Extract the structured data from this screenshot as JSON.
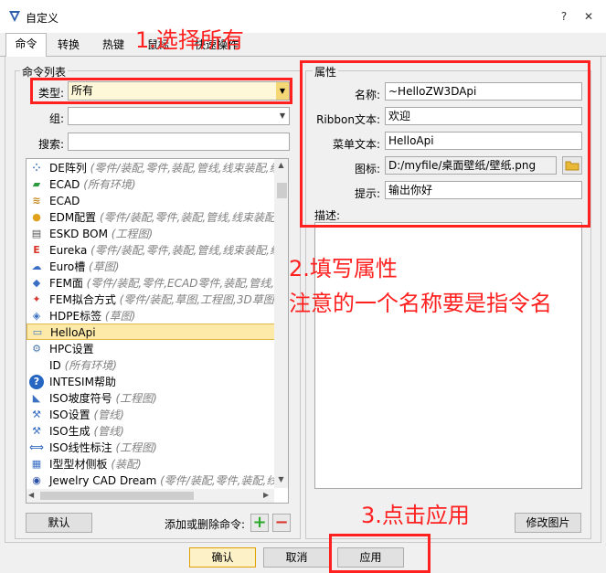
{
  "window": {
    "title": "自定义",
    "help_glyph": "?",
    "close_glyph": "✕"
  },
  "tabs": [
    {
      "label": "命令"
    },
    {
      "label": "转换"
    },
    {
      "label": "热键"
    },
    {
      "label": "鼠标"
    },
    {
      "label": "快速操作"
    }
  ],
  "command_list": {
    "group_title": "命令列表",
    "type_label": "类型:",
    "type_value": "所有",
    "group_label": "组:",
    "group_value": "",
    "search_label": "搜索:",
    "search_value": "",
    "items": [
      {
        "name": "DE阵列",
        "sub": "(零件/装配,零件,装配,管线,线束装配,线",
        "icon": "grid-icon",
        "glyph": "⁘",
        "color": "#3a6fc4"
      },
      {
        "name": "ECAD",
        "sub": "(所有环境)",
        "icon": "ecad-board-icon",
        "glyph": "▰",
        "color": "#2e9a40"
      },
      {
        "name": "ECAD",
        "sub": "",
        "icon": "ecad-chip-icon",
        "glyph": "≋",
        "color": "#c78a1d"
      },
      {
        "name": "EDM配置",
        "sub": "(零件/装配,零件,装配,管线,线束装配,",
        "icon": "edm-icon",
        "glyph": "●",
        "color": "#e0a21a"
      },
      {
        "name": "ESKD BOM",
        "sub": "(工程图)",
        "icon": "bom-icon",
        "glyph": "▤",
        "color": "#555555"
      },
      {
        "name": "Eureka",
        "sub": "(零件/装配,零件,装配,管线,线束装配,线束",
        "icon": "eureka-icon",
        "glyph": "E",
        "color": "#d9352b"
      },
      {
        "name": "Euro槽",
        "sub": "(草图)",
        "icon": "euro-slot-icon",
        "glyph": "☁",
        "color": "#3a6fc4"
      },
      {
        "name": "FEM面",
        "sub": "(零件/装配,零件,ECAD零件,装配,管线,线",
        "icon": "fem-face-icon",
        "glyph": "◆",
        "color": "#3a6fc4"
      },
      {
        "name": "FEM拟合方式",
        "sub": "(零件/装配,草图,工程图,3D草图,",
        "icon": "fem-fit-icon",
        "glyph": "✦",
        "color": "#d9352b"
      },
      {
        "name": "HDPE标签",
        "sub": "(草图)",
        "icon": "hdpe-tag-icon",
        "glyph": "◈",
        "color": "#3a6fc4"
      },
      {
        "name": "HelloApi",
        "sub": "",
        "icon": "helloapi-icon",
        "glyph": "▭",
        "color": "#3a78c8"
      },
      {
        "name": "HPC设置",
        "sub": "",
        "icon": "hpc-icon",
        "glyph": "⚙",
        "color": "#4c78b0"
      },
      {
        "name": "ID",
        "sub": "(所有环境)",
        "icon": "blank-icon",
        "glyph": "",
        "color": "#000000"
      },
      {
        "name": "INTESIM帮助",
        "sub": "",
        "icon": "help-icon",
        "glyph": "?",
        "color": "#2466c2"
      },
      {
        "name": "ISO坡度符号",
        "sub": "(工程图)",
        "icon": "slope-symbol-icon",
        "glyph": "◣",
        "color": "#3a6fc4"
      },
      {
        "name": "ISO设置",
        "sub": "(管线)",
        "icon": "iso-settings-icon",
        "glyph": "⚒",
        "color": "#3a6fc4"
      },
      {
        "name": "ISO生成",
        "sub": "(管线)",
        "icon": "iso-generate-icon",
        "glyph": "⚒",
        "color": "#3a6fc4"
      },
      {
        "name": "ISO线性标注",
        "sub": "(工程图)",
        "icon": "linear-dim-icon",
        "glyph": "⟺",
        "color": "#3a6fc4"
      },
      {
        "name": "I型型材侧板",
        "sub": "(装配)",
        "icon": "ibeam-icon",
        "glyph": "▦",
        "color": "#3a6fc4"
      },
      {
        "name": "Jewelry CAD Dream",
        "sub": "(零件/装配,零件,装配,线",
        "icon": "jewelry-icon",
        "glyph": "◉",
        "color": "#2a4fa8"
      }
    ],
    "default_button": "默认",
    "add_remove_label": "添加或删除命令:",
    "add_glyph": "+",
    "remove_glyph": "−"
  },
  "properties": {
    "group_title": "属性",
    "name_label": "名称:",
    "name_value": "~HelloZW3DApi",
    "ribbon_label": "Ribbon文本:",
    "ribbon_value": "欢迎",
    "menu_label": "菜单文本:",
    "menu_value": "HelloApi",
    "icon_label": "图标:",
    "icon_value": "D:/myfile/桌面壁纸/壁纸.png",
    "tip_label": "提示:",
    "tip_value": "输出你好",
    "desc_label": "描述:",
    "modify_image_button": "修改图片"
  },
  "footer": {
    "ok": "确认",
    "cancel": "取消",
    "apply": "应用"
  },
  "annotations": {
    "step1": "1.选择所有",
    "step2_line1": "2.填写属性",
    "step2_line2": "注意的一个名称要是指令名",
    "step3": "3.点击应用"
  },
  "colors": {
    "highlight": "#fde9a8",
    "annotation": "#ff2020",
    "add": "#2aa82a",
    "remove": "#d9352b"
  }
}
